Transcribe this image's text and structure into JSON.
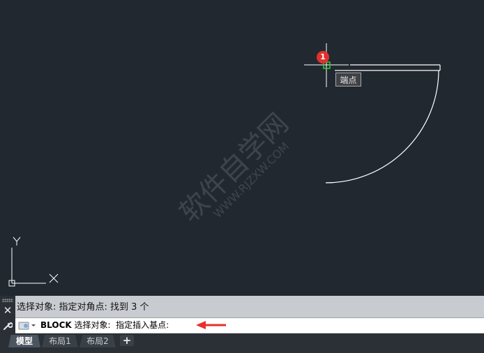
{
  "canvas": {
    "snap_tooltip": "端点",
    "marker_badge": "1",
    "ucs": {
      "y_label": "Y",
      "x_label": "X"
    }
  },
  "command": {
    "history": "选择对象: 指定对角点: 找到 3 个",
    "input_keyword": "BLOCK",
    "input_rest": " 选择对象:  指定插入基点:"
  },
  "tabs": [
    {
      "label": "模型",
      "active": true
    },
    {
      "label": "布局1",
      "active": false
    },
    {
      "label": "布局2",
      "active": false
    }
  ],
  "tab_add_label": "+",
  "icons": [
    "close-icon",
    "customize-wrench-icon",
    "recent-commands-icon",
    "red-arrow-icon",
    "crosshair-cursor-icon",
    "endpoint-snap-icon"
  ]
}
